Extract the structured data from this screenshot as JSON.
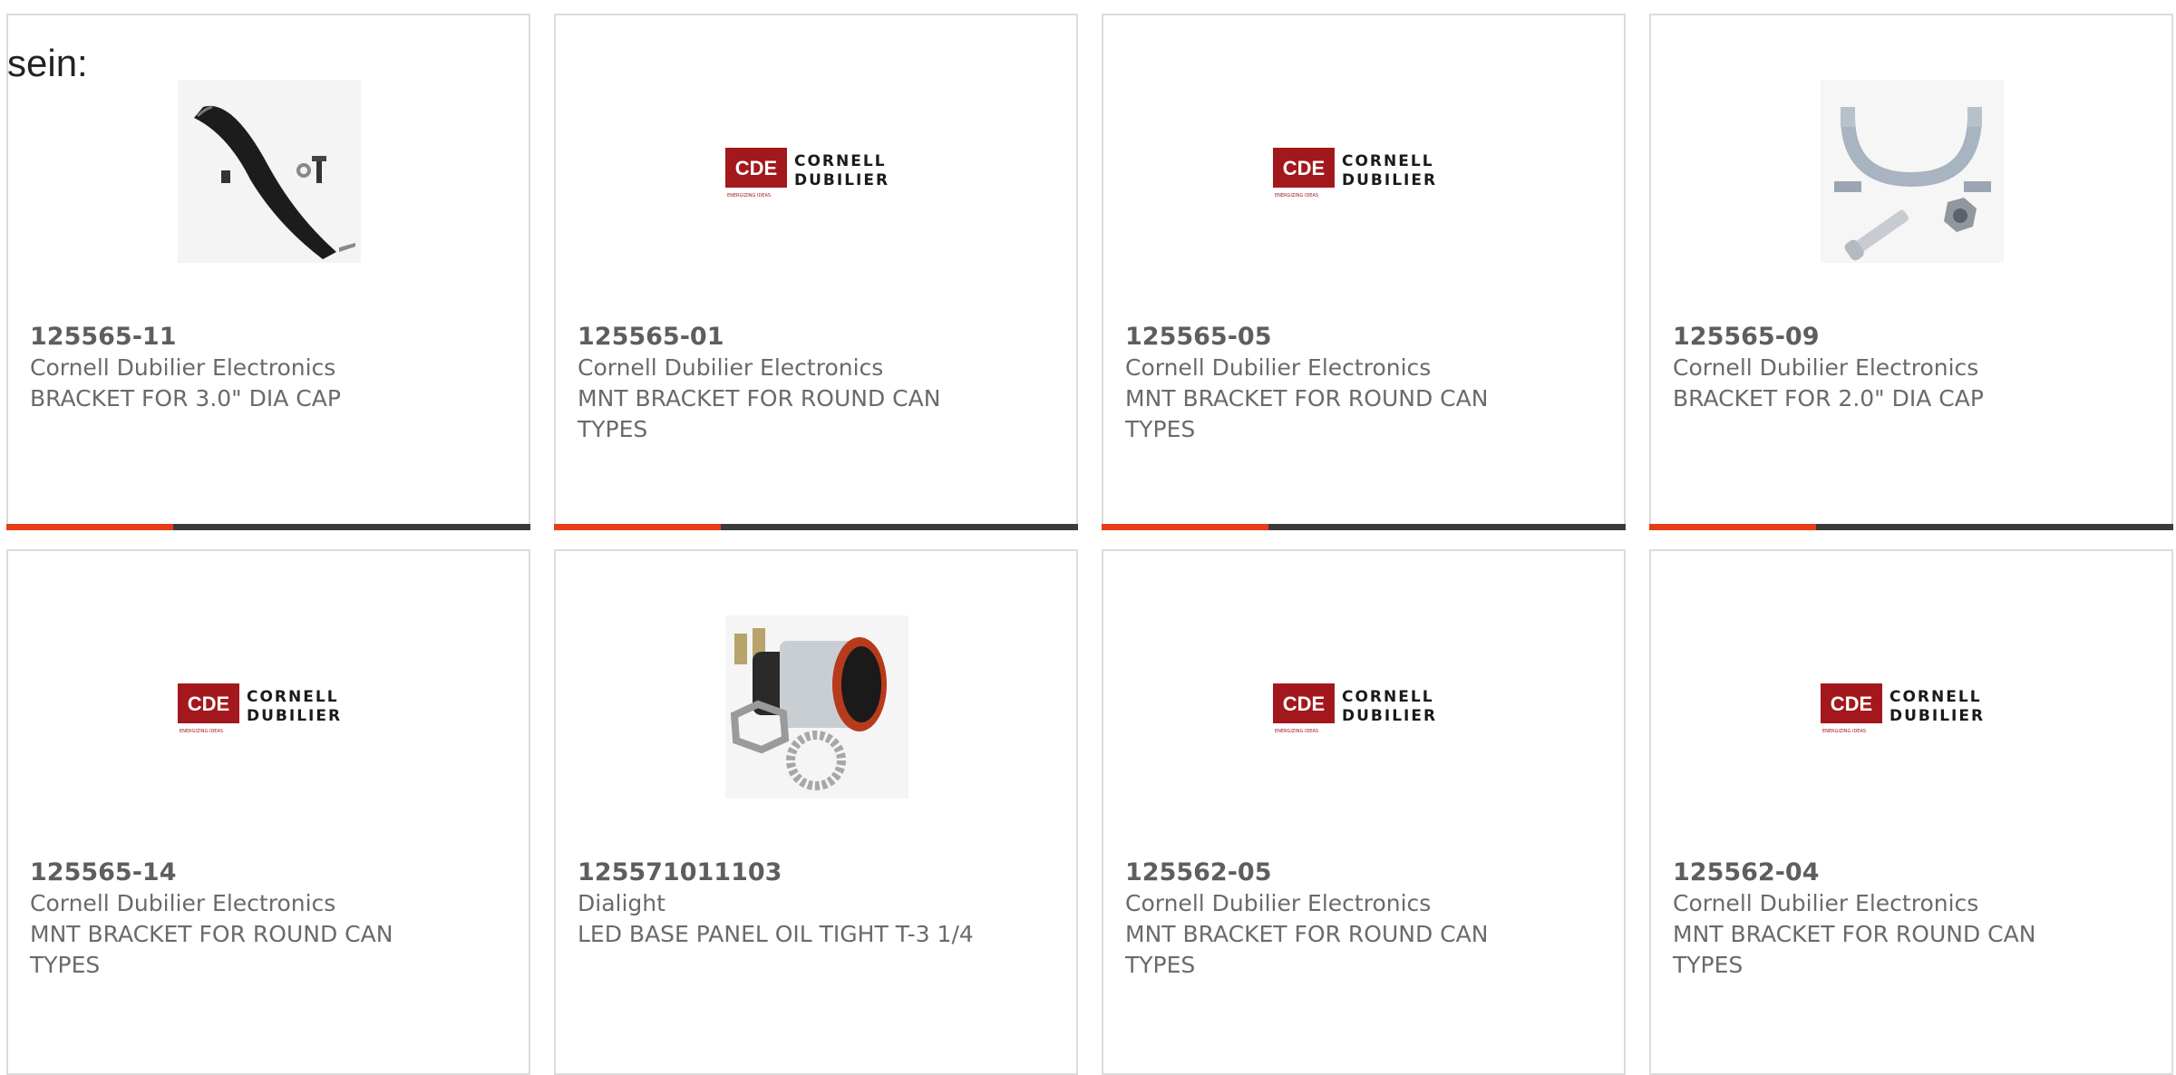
{
  "intro": "sein:",
  "colors": {
    "accent": "#e63d16",
    "bar": "#3b3b3b",
    "brand_red": "#a3181c"
  },
  "products": [
    {
      "part_number": "125565-11",
      "manufacturer": "Cornell Dubilier Electronics",
      "description": "BRACKET FOR 3.0\" DIA CAP",
      "image": "black-bracket-photo"
    },
    {
      "part_number": "125565-01",
      "manufacturer": "Cornell Dubilier Electronics",
      "description": "MNT BRACKET FOR ROUND CAN TYPES",
      "image": "cde-logo",
      "logo": {
        "mark": "CDE",
        "line1": "CORNELL",
        "line2": "DUBILIER",
        "tagline": "ENERGIZING IDEAS"
      }
    },
    {
      "part_number": "125565-05",
      "manufacturer": "Cornell Dubilier Electronics",
      "description": "MNT BRACKET FOR ROUND CAN TYPES",
      "image": "cde-logo",
      "logo": {
        "mark": "CDE",
        "line1": "CORNELL",
        "line2": "DUBILIER",
        "tagline": "ENERGIZING IDEAS"
      }
    },
    {
      "part_number": "125565-09",
      "manufacturer": "Cornell Dubilier Electronics",
      "description": "BRACKET FOR 2.0\" DIA CAP",
      "image": "metal-clamp-photo"
    },
    {
      "part_number": "125565-14",
      "manufacturer": "Cornell Dubilier Electronics",
      "description": "MNT BRACKET FOR ROUND CAN TYPES",
      "image": "cde-logo",
      "logo": {
        "mark": "CDE",
        "line1": "CORNELL",
        "line2": "DUBILIER",
        "tagline": "ENERGIZING IDEAS"
      }
    },
    {
      "part_number": "125571011103",
      "manufacturer": "Dialight",
      "description": "LED BASE PANEL OIL TIGHT T-3 1/4",
      "image": "led-base-photo"
    },
    {
      "part_number": "125562-05",
      "manufacturer": "Cornell Dubilier Electronics",
      "description": "MNT BRACKET FOR ROUND CAN TYPES",
      "image": "cde-logo",
      "logo": {
        "mark": "CDE",
        "line1": "CORNELL",
        "line2": "DUBILIER",
        "tagline": "ENERGIZING IDEAS"
      }
    },
    {
      "part_number": "125562-04",
      "manufacturer": "Cornell Dubilier Electronics",
      "description": "MNT BRACKET FOR ROUND CAN TYPES",
      "image": "cde-logo",
      "logo": {
        "mark": "CDE",
        "line1": "CORNELL",
        "line2": "DUBILIER",
        "tagline": "ENERGIZING IDEAS"
      }
    }
  ]
}
